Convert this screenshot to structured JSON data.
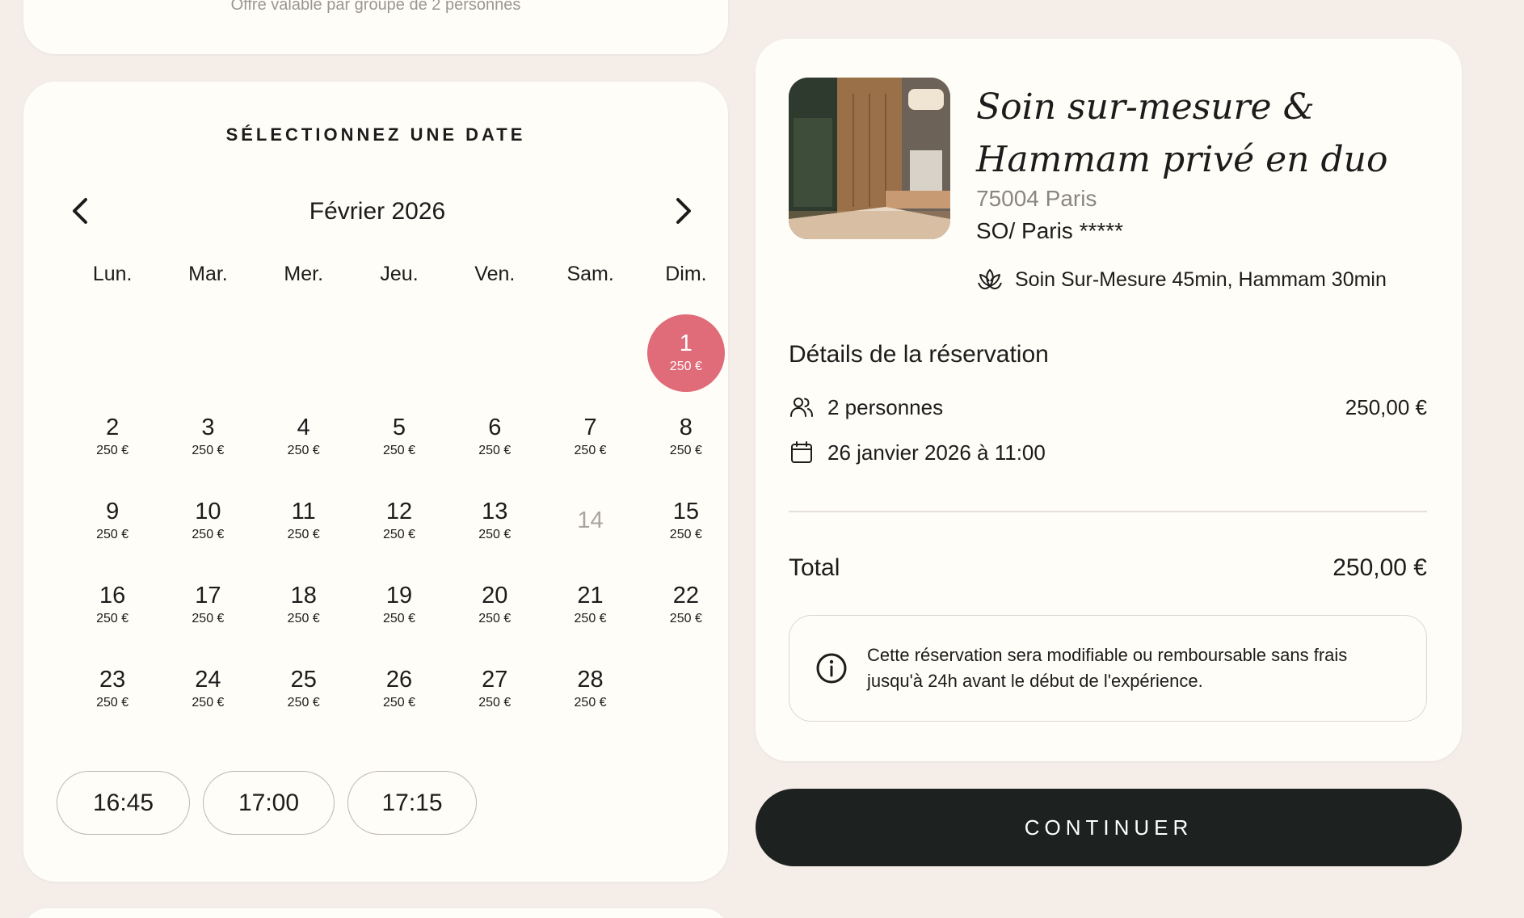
{
  "offer_note": "Offre valable par groupe de 2 personnes",
  "calendar": {
    "title": "SÉLECTIONNEZ UNE DATE",
    "month": "Février 2026",
    "weekdays": [
      "Lun.",
      "Mar.",
      "Mer.",
      "Jeu.",
      "Ven.",
      "Sam.",
      "Dim."
    ],
    "days": {
      "d1": {
        "num": "1",
        "price": "250 €"
      },
      "d2": {
        "num": "2",
        "price": "250 €"
      },
      "d3": {
        "num": "3",
        "price": "250 €"
      },
      "d4": {
        "num": "4",
        "price": "250 €"
      },
      "d5": {
        "num": "5",
        "price": "250 €"
      },
      "d6": {
        "num": "6",
        "price": "250 €"
      },
      "d7": {
        "num": "7",
        "price": "250 €"
      },
      "d8": {
        "num": "8",
        "price": "250 €"
      },
      "d9": {
        "num": "9",
        "price": "250 €"
      },
      "d10": {
        "num": "10",
        "price": "250 €"
      },
      "d11": {
        "num": "11",
        "price": "250 €"
      },
      "d12": {
        "num": "12",
        "price": "250 €"
      },
      "d13": {
        "num": "13",
        "price": "250 €"
      },
      "d14": {
        "num": "14",
        "price": ""
      },
      "d15": {
        "num": "15",
        "price": "250 €"
      },
      "d16": {
        "num": "16",
        "price": "250 €"
      },
      "d17": {
        "num": "17",
        "price": "250 €"
      },
      "d18": {
        "num": "18",
        "price": "250 €"
      },
      "d19": {
        "num": "19",
        "price": "250 €"
      },
      "d20": {
        "num": "20",
        "price": "250 €"
      },
      "d21": {
        "num": "21",
        "price": "250 €"
      },
      "d22": {
        "num": "22",
        "price": "250 €"
      },
      "d23": {
        "num": "23",
        "price": "250 €"
      },
      "d24": {
        "num": "24",
        "price": "250 €"
      },
      "d25": {
        "num": "25",
        "price": "250 €"
      },
      "d26": {
        "num": "26",
        "price": "250 €"
      },
      "d27": {
        "num": "27",
        "price": "250 €"
      },
      "d28": {
        "num": "28",
        "price": "250 €"
      }
    },
    "selected_day": "1",
    "unavailable_days": [
      "14"
    ],
    "selected_color": "#e06b79",
    "time_slots": [
      "16:45",
      "17:00",
      "17:15"
    ]
  },
  "experience": {
    "title": "Soin sur-mesure & Hammam privé en duo",
    "address": "75004 Paris",
    "venue": "SO/ Paris *****",
    "services_icon": "lotus-icon",
    "services": "Soin Sur-Mesure 45min, Hammam 30min"
  },
  "reservation": {
    "title": "Détails de la réservation",
    "guests_icon": "users-icon",
    "guests": "2 personnes",
    "guests_price": "250,00 €",
    "date_icon": "calendar-icon",
    "date": "26 janvier 2026 à 11:00",
    "total_label": "Total",
    "total_value": "250,00 €",
    "info_icon": "info-icon",
    "info_text": "Cette réservation sera modifiable ou remboursable sans frais jusqu'à 24h avant le début de l'expérience."
  },
  "continue_label": "CONTINUER",
  "button_color": "#1d211f",
  "background_color": "#f4ede8"
}
